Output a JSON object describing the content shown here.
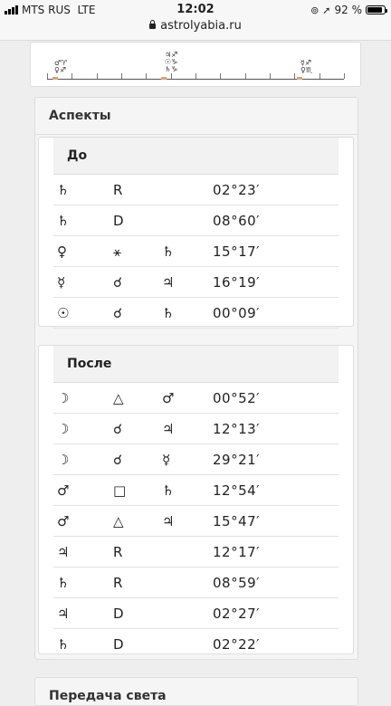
{
  "status": {
    "carrier": "MTS RUS",
    "network": "LTE",
    "time": "12:02",
    "battery": "92 %"
  },
  "browser": {
    "url": "astrolyabia.ru"
  },
  "strip": {
    "groups": [
      {
        "lines": [
          "♂♈",
          "♀♐"
        ]
      },
      {
        "lines": [
          "♃♐",
          "☉♑",
          "♄♑"
        ]
      },
      {
        "lines": [
          "☿♐",
          "♀♏"
        ]
      }
    ]
  },
  "aspects": {
    "title": "Аспекты",
    "before": {
      "title": "До",
      "rows": [
        [
          "♄",
          "R",
          "",
          "02°23′"
        ],
        [
          "♄",
          "D",
          "",
          "08°60′"
        ],
        [
          "♀",
          "⚹",
          "♄",
          "15°17′"
        ],
        [
          "☿",
          "☌",
          "♃",
          "16°19′"
        ],
        [
          "☉",
          "☌",
          "♄",
          "00°09′"
        ]
      ]
    },
    "after": {
      "title": "После",
      "rows": [
        [
          "☽",
          "△",
          "♂",
          "00°52′"
        ],
        [
          "☽",
          "☌",
          "♃",
          "12°13′"
        ],
        [
          "☽",
          "☌",
          "☿",
          "29°21′"
        ],
        [
          "♂",
          "□",
          "♄",
          "12°54′"
        ],
        [
          "♂",
          "△",
          "♃",
          "15°47′"
        ],
        [
          "♃",
          "R",
          "",
          "12°17′"
        ],
        [
          "♄",
          "R",
          "",
          "08°59′"
        ],
        [
          "♃",
          "D",
          "",
          "02°27′"
        ],
        [
          "♄",
          "D",
          "",
          "02°22′"
        ]
      ]
    }
  },
  "next_section": {
    "title": "Передача света"
  }
}
